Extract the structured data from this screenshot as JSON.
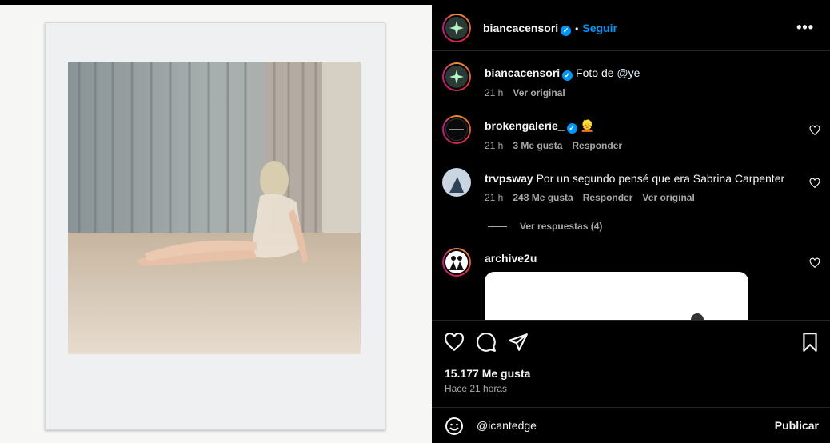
{
  "post": {
    "author": "biancacensori",
    "follow_label": "Seguir",
    "more_label": "•••"
  },
  "caption": {
    "author": "biancacensori",
    "text": "Foto de ",
    "mention": "@ye",
    "time": "21 h",
    "translate": "Ver original"
  },
  "comments": [
    {
      "author": "brokengalerie_",
      "verified": true,
      "text": "👱",
      "time": "21 h",
      "likes": "3 Me gusta",
      "reply": "Responder"
    },
    {
      "author": "trvpsway",
      "verified": false,
      "text": "Por un segundo pensé que era Sabrina Carpenter",
      "time": "21 h",
      "likes": "248 Me gusta",
      "reply": "Responder",
      "translate": "Ver original"
    },
    {
      "author": "archive2u",
      "verified": false,
      "text": ""
    }
  ],
  "view_replies": "Ver respuestas (4)",
  "like_count": "15.177 Me gusta",
  "posted_ago": "Hace 21 horas",
  "composer": {
    "value": "@icantedge",
    "publish_label": "Publicar"
  },
  "colors": {
    "accent": "#0095f6",
    "background": "#000000",
    "muted": "#a8a8a8"
  }
}
